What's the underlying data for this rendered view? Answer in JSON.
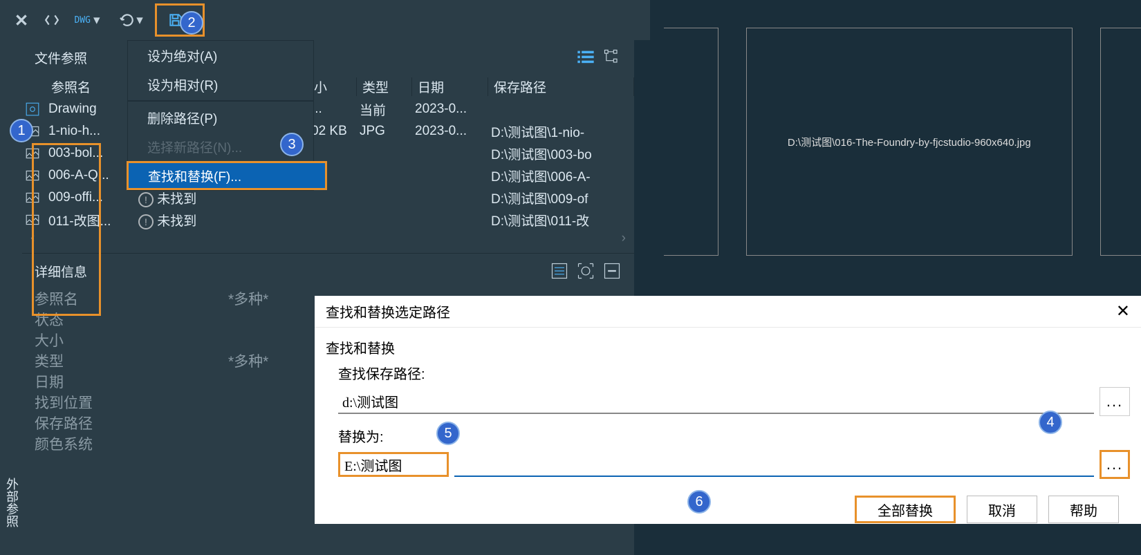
{
  "topbar": {
    "dwg_label": "DWG"
  },
  "panel": {
    "title": "文件参照",
    "columns": {
      "name": "参照名",
      "size": "小",
      "type": "类型",
      "date": "日期",
      "path": "保存路径"
    },
    "rows": [
      {
        "name": "Drawing",
        "size": "...",
        "type": "当前",
        "date": "2023-0...",
        "path": ""
      },
      {
        "name": "1-nio-h...",
        "size": "02 KB",
        "type": "JPG",
        "date": "2023-0...",
        "path": "D:\\测试图\\1-nio-"
      },
      {
        "name": "003-bol...",
        "size": "",
        "type": "",
        "date": "",
        "path": "D:\\测试图\\003-bo"
      },
      {
        "name": "006-A-Q...",
        "size": "",
        "type": "",
        "date": "",
        "path": "D:\\测试图\\006-A-"
      },
      {
        "name": "009-offi...",
        "status": "未找到",
        "size": "",
        "type": "",
        "date": "",
        "path": "D:\\测试图\\009-of"
      },
      {
        "name": "011-改图...",
        "status": "未找到",
        "size": "",
        "type": "",
        "date": "",
        "path": "D:\\测试图\\011-改"
      }
    ]
  },
  "context_menu": {
    "absolute": "设为绝对(A)",
    "relative": "设为相对(R)",
    "remove": "删除路径(P)",
    "select_new": "选择新路径(N)...",
    "find_replace": "查找和替换(F)..."
  },
  "details": {
    "title": "详细信息",
    "rows": [
      {
        "k": "参照名",
        "v": "*多种*"
      },
      {
        "k": "状态",
        "v": ""
      },
      {
        "k": "大小",
        "v": ""
      },
      {
        "k": "类型",
        "v": "*多种*"
      },
      {
        "k": "日期",
        "v": ""
      },
      {
        "k": "找到位置",
        "v": ""
      },
      {
        "k": "保存路径",
        "v": ""
      },
      {
        "k": "颜色系统",
        "v": ""
      }
    ]
  },
  "preview": {
    "path": "D:\\测试图\\016-The-Foundry-by-fjcstudio-960x640.jpg"
  },
  "dialog": {
    "title": "查找和替换选定路径",
    "group": "查找和替换",
    "find_label": "查找保存路径:",
    "find_value": "d:\\测试图",
    "replace_label": "替换为:",
    "replace_value": "E:\\测试图",
    "browse": "...",
    "replace_all": "全部替换",
    "cancel": "取消",
    "help": "帮助"
  },
  "sidebar": {
    "label": "外部参照"
  },
  "callouts": {
    "c1": "1",
    "c2": "2",
    "c3": "3",
    "c4": "4",
    "c5": "5",
    "c6": "6"
  }
}
